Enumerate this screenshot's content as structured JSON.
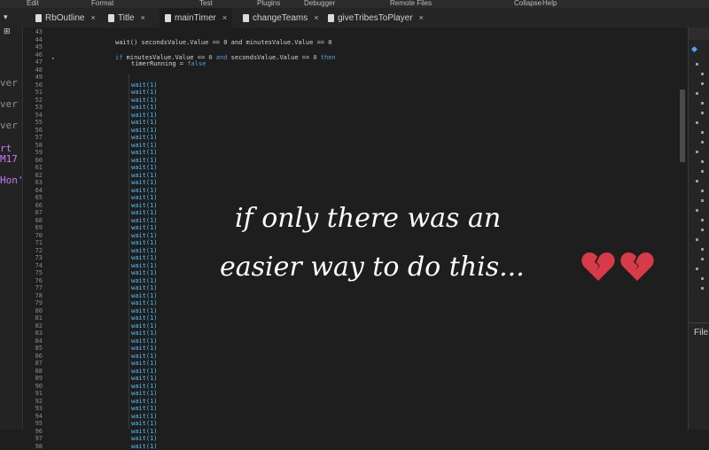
{
  "menubar": [
    "Edit",
    "Format",
    "Test",
    "Plugins",
    "Debugger",
    "Remote Files",
    "Collapse",
    "Help"
  ],
  "tabs": [
    {
      "label": "RbOutline",
      "active": false
    },
    {
      "label": "Title",
      "active": false
    },
    {
      "label": "mainTimer",
      "active": true
    },
    {
      "label": "changeTeams",
      "active": false
    },
    {
      "label": "giveTribesToPlayer",
      "active": false
    }
  ],
  "left_panel_lines": [
    "ver",
    "ver",
    "ver",
    "rt",
    "M17",
    "Hon'"
  ],
  "gutter": {
    "first_line": 43,
    "last_line": 98
  },
  "code": {
    "line_45": "wait() secondsValue.Value == 0 and minutesValue.Value == 0",
    "line_47_if": "if",
    "line_47_mid": "minutesValue.Value == ",
    "line_47_zero": "0",
    "line_47_and": " and ",
    "line_47_sec": "secondsValue.Value == ",
    "line_47_then": "then",
    "line_48_text": "timerRunning = ",
    "line_48_value": "false",
    "wait_call": "wait(1)"
  },
  "overlay": {
    "line1": "if only there was an",
    "line2": "easier way to do this...",
    "emoji": "broken-heart",
    "emoji_count": 2,
    "heart_color": "#d63b47"
  },
  "right_panel": {
    "label": "File"
  }
}
